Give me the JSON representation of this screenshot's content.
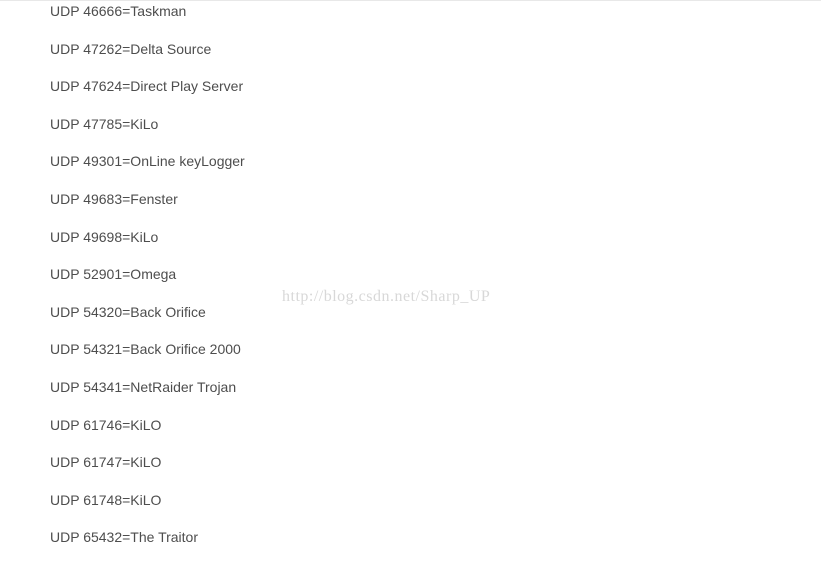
{
  "entries": [
    "UDP 46666=Taskman",
    "UDP 47262=Delta Source",
    "UDP 47624=Direct Play Server",
    "UDP 47785=KiLo",
    "UDP 49301=OnLine keyLogger",
    "UDP 49683=Fenster",
    "UDP 49698=KiLo",
    "UDP 52901=Omega",
    "UDP 54320=Back Orifice",
    "UDP 54321=Back Orifice 2000",
    "UDP 54341=NetRaider Trojan",
    "UDP 61746=KiLO",
    "UDP 61747=KiLO",
    "UDP 61748=KiLO",
    "UDP 65432=The Traitor"
  ],
  "watermark": "http://blog.csdn.net/Sharp_UP"
}
